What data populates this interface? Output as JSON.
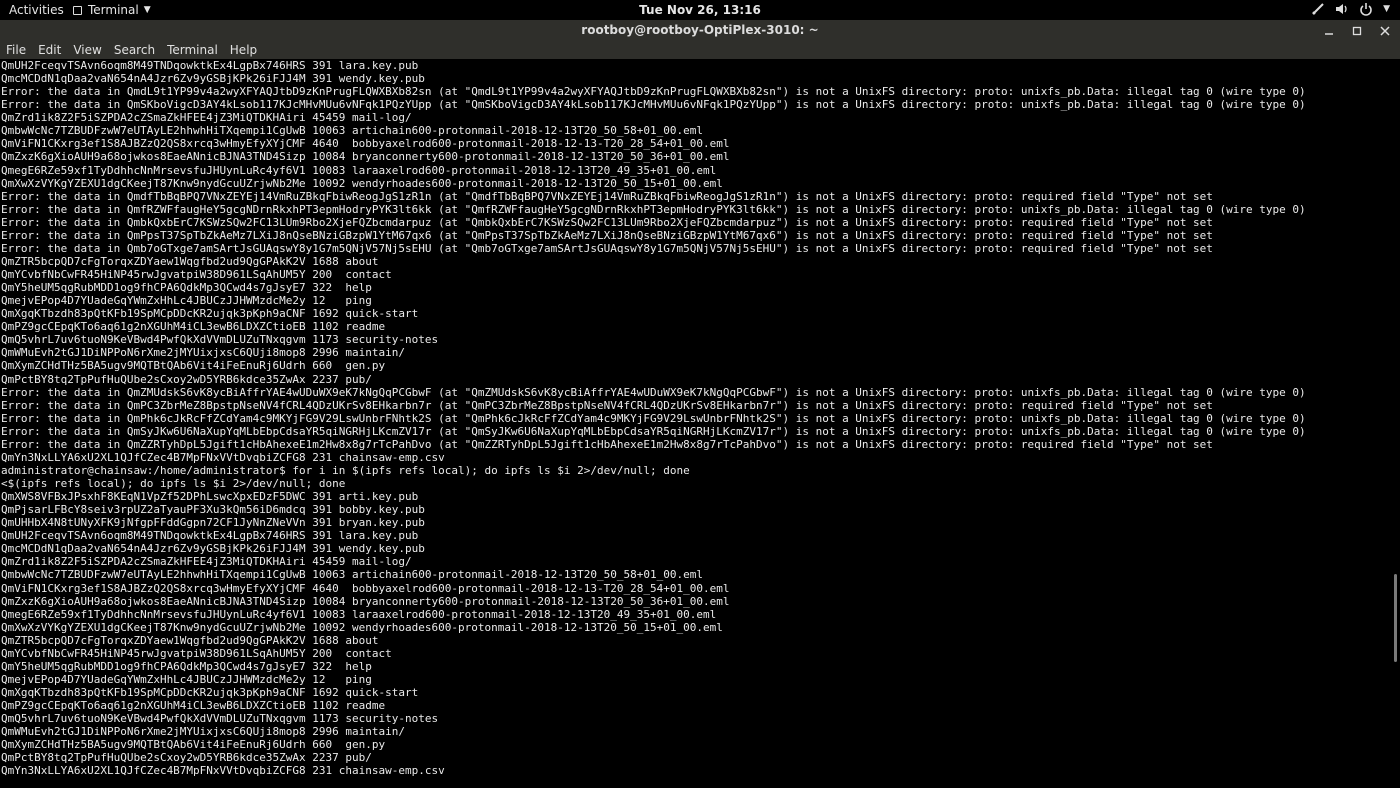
{
  "topbar": {
    "activities": "Activities",
    "app_name": "Terminal",
    "clock": "Tue Nov 26, 13:16"
  },
  "window": {
    "title": "rootboy@rootboy-OptiPlex-3010: ~"
  },
  "menu": [
    "File",
    "Edit",
    "View",
    "Search",
    "Terminal",
    "Help"
  ],
  "icons": {
    "app": "terminal-app-icon",
    "network": "network-icon",
    "volume": "volume-icon",
    "power": "power-icon",
    "minimize": "minimize-icon",
    "maximize": "maximize-icon",
    "close": "close-icon"
  },
  "terminal": {
    "lines": [
      "QmUH2FceqvTSAvn6oqm8M49TNDqowktkEx4LgpBx746HRS 391 lara.key.pub",
      "QmcMCDdN1qDaa2vaN654nA4Jzr6Zv9yGSBjKPk26iFJJ4M 391 wendy.key.pub",
      "Error: the data in QmdL9t1YP99v4a2wyXFYAQJtbD9zKnPrugFLQWXBXb82sn (at \"QmdL9t1YP99v4a2wyXFYAQJtbD9zKnPrugFLQWXBXb82sn\") is not a UnixFS directory: proto: unixfs_pb.Data: illegal tag 0 (wire type 0)",
      "Error: the data in QmSKboVigcD3AY4kLsob117KJcMHvMUu6vNFqk1PQzYUpp (at \"QmSKboVigcD3AY4kLsob117KJcMHvMUu6vNFqk1PQzYUpp\") is not a UnixFS directory: proto: unixfs_pb.Data: illegal tag 0 (wire type 0)",
      "QmZrd1ik8Z2F5iSZPDA2cZSmaZkHFEE4jZ3MiQTDKHAiri 45459 mail-log/",
      "QmbwWcNc7TZBUDFzwW7eUTAyLE2hhwhHiTXqempi1CgUwB 10063 artichain600-protonmail-2018-12-13T20_50_58+01_00.eml",
      "QmViFN1CKxrg3ef1S8AJBZzQ2QS8xrcq3wHmyEfyXYjCMF 4640  bobbyaxelrod600-protonmail-2018-12-13-T20_28_54+01_00.eml",
      "QmZxzK6gXioAUH9a68ojwkos8EaeANnicBJNA3TND4Sizp 10084 bryanconnerty600-protonmail-2018-12-13T20_50_36+01_00.eml",
      "QmegE6RZe59xf1TyDdhhcNnMrsevsfuJHUynLuRc4yf6V1 10083 laraaxelrod600-protonmail-2018-12-13T20_49_35+01_00.eml",
      "QmXwXzVYKgYZEXU1dgCKeejT87Knw9nydGcuUZrjwNb2Me 10092 wendyrhoades600-protonmail-2018-12-13T20_50_15+01_00.eml",
      "Error: the data in QmdfTbBqBPQ7VNxZEYEj14VmRuZBkqFbiwReogJgS1zR1n (at \"QmdfTbBqBPQ7VNxZEYEj14VmRuZBkqFbiwReogJgS1zR1n\") is not a UnixFS directory: proto: required field \"Type\" not set",
      "Error: the data in QmfRZWFfaugHeY5gcgNDrnRkxhPT3epmHodryPYK3lt6kk (at \"QmfRZWFfaugHeY5gcgNDrnRkxhPT3epmHodryPYK3lt6kk\") is not a UnixFS directory: proto: unixfs_pb.Data: illegal tag 0 (wire type 0)",
      "Error: the data in QmbkQxbErC7KSWzSQw2FC13LUm9Rbo2XjeFQZbcmdarpuz (at \"QmbkQxbErC7KSWzSQw2FC13LUm9Rbo2XjeFQZbcmdarpuz\") is not a UnixFS directory: proto: required field \"Type\" not set",
      "Error: the data in QmPpsT37SpTbZkAeMz7LXiJ8nQseBNziGBzpW1YtM67qx6 (at \"QmPpsT37SpTbZkAeMz7LXiJ8nQseBNziGBzpW1YtM67qx6\") is not a UnixFS directory: proto: required field \"Type\" not set",
      "Error: the data in Qmb7oGTxge7amSArtJsGUAqswY8y1G7m5QNjV57Nj5sEHU (at \"Qmb7oGTxge7amSArtJsGUAqswY8y1G7m5QNjV57Nj5sEHU\") is not a UnixFS directory: proto: required field \"Type\" not set",
      "QmZTR5bcpQD7cFgTorqxZDYaew1Wqgfbd2ud9QgGPAkK2V 1688 about",
      "QmYCvbfNbCwFR45HiNP45rwJgvatpiW38D961LSqAhUM5Y 200  contact",
      "QmY5heUM5qgRubMDD1og9fhCPA6QdkMp3QCwd4s7gJsyE7 322  help",
      "QmejvEPop4D7YUadeGqYWmZxHhLc4JBUCzJJHWMzdcMe2y 12   ping",
      "QmXgqKTbzdh83pQtKFb19SpMCpDDcKR2ujqk3pKph9aCNF 1692 quick-start",
      "QmPZ9gcCEpqKTo6aq61g2nXGUhM4iCL3ewB6LDXZCtioEB 1102 readme",
      "QmQ5vhrL7uv6tuoN9KeVBwd4PwfQkXdVVmDLUZuTNxqgvm 1173 security-notes",
      "QmWMuEvh2tGJ1DiNPPoN6rXme2jMYUixjxsC6QUji8mop8 2996 maintain/",
      "QmXymZCHdTHz5BA5ugv9MQTBtQAb6Vit4iFeEnuRj6Udrh 660  gen.py",
      "QmPctBY8tq2TpPufHuQUbe2sCxoy2wD5YRB6kdce35ZwAx 2237 pub/",
      "Error: the data in QmZMUdskS6vK8ycBiAffrYAE4wUDuWX9eK7kNgQqPCGbwF (at \"QmZMUdskS6vK8ycBiAffrYAE4wUDuWX9eK7kNgQqPCGbwF\") is not a UnixFS directory: proto: unixfs_pb.Data: illegal tag 0 (wire type 0)",
      "Error: the data in QmPC3ZbrMeZ8BpstpNseNV4fCRL4QDzUKrSv8EHkarbn7r (at \"QmPC3ZbrMeZ8BpstpNseNV4fCRL4QDzUKrSv8EHkarbn7r\") is not a UnixFS directory: proto: required field \"Type\" not set",
      "Error: the data in QmPhk6cJkRcFfZCdYam4c9MKYjFG9V29LswUnbrFNhtk2S (at \"QmPhk6cJkRcFfZCdYam4c9MKYjFG9V29LswUnbrFNhtk2S\") is not a UnixFS directory: proto: unixfs_pb.Data: illegal tag 0 (wire type 0)",
      "Error: the data in QmSyJKw6U6NaXupYqMLbEbpCdsaYR5qiNGRHjLKcmZV17r (at \"QmSyJKw6U6NaXupYqMLbEbpCdsaYR5qiNGRHjLKcmZV17r\") is not a UnixFS directory: proto: unixfs_pb.Data: illegal tag 0 (wire type 0)",
      "Error: the data in QmZZRTyhDpL5Jgift1cHbAhexeE1m2Hw8x8g7rTcPahDvo (at \"QmZZRTyhDpL5Jgift1cHbAhexeE1m2Hw8x8g7rTcPahDvo\") is not a UnixFS directory: proto: required field \"Type\" not set",
      "QmYn3NxLLYA6xU2XL1QJfCZec4B7MpFNxVVtDvqbiZCFG8 231 chainsaw-emp.csv",
      "administrator@chainsaw:/home/administrator$ for i in $(ipfs refs local); do ipfs ls $i 2>/dev/null; done",
      "<$(ipfs refs local); do ipfs ls $i 2>/dev/null; done",
      "QmXWS8VFBxJPsxhF8KEqN1VpZf52DPhLswcXpxEDzF5DWC 391 arti.key.pub",
      "QmPjsarLFBcY8seiv3rpUZ2aTyauPF3Xu3kQm56iD6mdcq 391 bobby.key.pub",
      "QmUHHbX4N8tUNyXFK9jNfgpFFddGgpn72CF1JyNnZNeVVn 391 bryan.key.pub",
      "QmUH2FceqvTSAvn6oqm8M49TNDqowktkEx4LgpBx746HRS 391 lara.key.pub",
      "QmcMCDdN1qDaa2vaN654nA4Jzr6Zv9yGSBjKPk26iFJJ4M 391 wendy.key.pub",
      "QmZrd1ik8Z2F5iSZPDA2cZSmaZkHFEE4jZ3MiQTDKHAiri 45459 mail-log/",
      "QmbwWcNc7TZBUDFzwW7eUTAyLE2hhwhHiTXqempi1CgUwB 10063 artichain600-protonmail-2018-12-13T20_50_58+01_00.eml",
      "QmViFN1CKxrg3ef1S8AJBZzQ2QS8xrcq3wHmyEfyXYjCMF 4640  bobbyaxelrod600-protonmail-2018-12-13-T20_28_54+01_00.eml",
      "QmZxzK6gXioAUH9a68ojwkos8EaeANnicBJNA3TND4Sizp 10084 bryanconnerty600-protonmail-2018-12-13T20_50_36+01_00.eml",
      "QmegE6RZe59xf1TyDdhhcNnMrsevsfuJHUynLuRc4yf6V1 10083 laraaxelrod600-protonmail-2018-12-13T20_49_35+01_00.eml",
      "QmXwXzVYKgYZEXU1dgCKeejT87Knw9nydGcuUZrjwNb2Me 10092 wendyrhoades600-protonmail-2018-12-13T20_50_15+01_00.eml",
      "QmZTR5bcpQD7cFgTorqxZDYaew1Wqgfbd2ud9QgGPAkK2V 1688 about",
      "QmYCvbfNbCwFR45HiNP45rwJgvatpiW38D961LSqAhUM5Y 200  contact",
      "QmY5heUM5qgRubMDD1og9fhCPA6QdkMp3QCwd4s7gJsyE7 322  help",
      "QmejvEPop4D7YUadeGqYWmZxHhLc4JBUCzJJHWMzdcMe2y 12   ping",
      "QmXgqKTbzdh83pQtKFb19SpMCpDDcKR2ujqk3pKph9aCNF 1692 quick-start",
      "QmPZ9gcCEpqKTo6aq61g2nXGUhM4iCL3ewB6LDXZCtioEB 1102 readme",
      "QmQ5vhrL7uv6tuoN9KeVBwd4PwfQkXdVVmDLUZuTNxqgvm 1173 security-notes",
      "QmWMuEvh2tGJ1DiNPPoN6rXme2jMYUixjxsC6QUji8mop8 2996 maintain/",
      "QmXymZCHdTHz5BA5ugv9MQTBtQAb6Vit4iFeEnuRj6Udrh 660  gen.py",
      "QmPctBY8tq2TpPufHuQUbe2sCxoy2wD5YRB6kdce35ZwAx 2237 pub/",
      "QmYn3NxLLYA6xU2XL1QJfCZec4B7MpFNxVVtDvqbiZCFG8 231 chainsaw-emp.csv"
    ]
  }
}
